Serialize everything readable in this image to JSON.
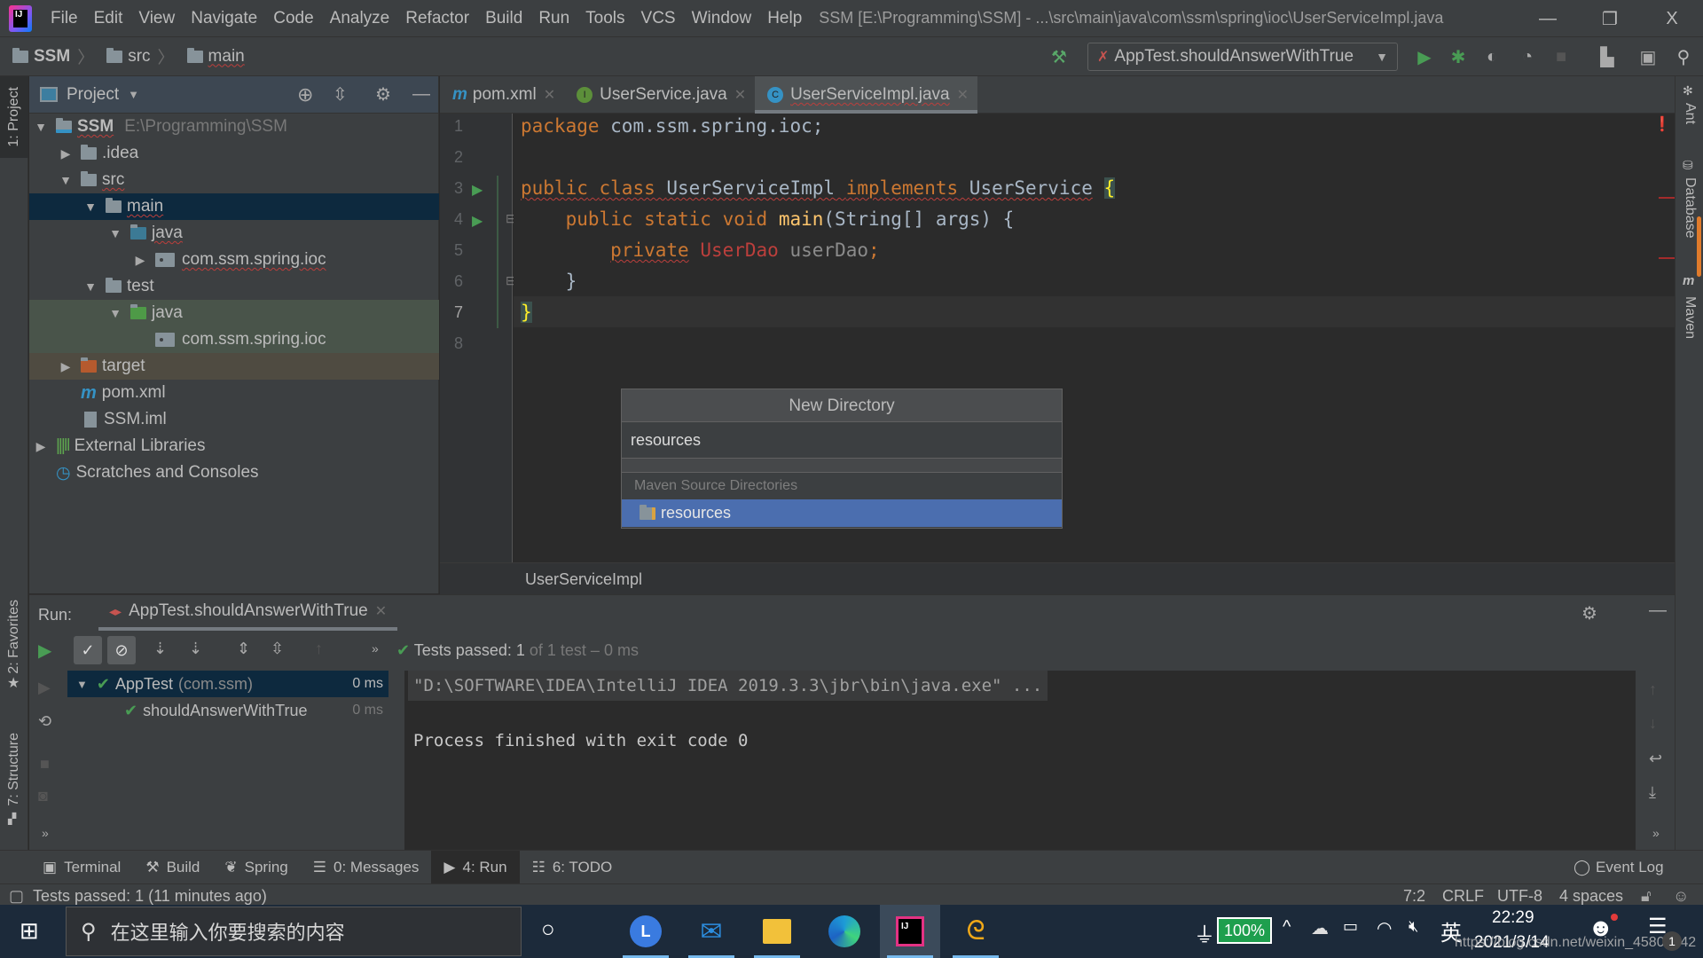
{
  "app": {
    "logo_text": "IJ",
    "window_title": "SSM [E:\\Programming\\SSM] - ...\\src\\main\\java\\com\\ssm\\spring\\ioc\\UserServiceImpl.java",
    "menu": [
      "File",
      "Edit",
      "View",
      "Navigate",
      "Code",
      "Analyze",
      "Refactor",
      "Build",
      "Run",
      "Tools",
      "VCS",
      "Window",
      "Help"
    ],
    "window_controls": {
      "minimize": "—",
      "restore": "❐",
      "close": "X"
    }
  },
  "navbar": {
    "breadcrumbs": [
      "SSM",
      "src",
      "main"
    ],
    "run_config": "AppTest.shouldAnswerWithTrue"
  },
  "left_strip": {
    "project": "1: Project",
    "favorites": "2: Favorites",
    "structure": "7: Structure"
  },
  "right_strip": {
    "ant": "Ant",
    "database": "Database",
    "maven": "Maven"
  },
  "project_panel": {
    "title": "Project",
    "tree": [
      {
        "label": "SSM",
        "path": "E:\\Programming\\SSM",
        "depth": 0,
        "expanded": true,
        "icon": "module-folder-icon"
      },
      {
        "label": ".idea",
        "depth": 1,
        "expanded": false,
        "icon": "folder-icon"
      },
      {
        "label": "src",
        "depth": 1,
        "expanded": true,
        "icon": "folder-icon"
      },
      {
        "label": "main",
        "depth": 2,
        "expanded": true,
        "icon": "folder-icon",
        "selected": true
      },
      {
        "label": "java",
        "depth": 3,
        "expanded": true,
        "icon": "source-folder-icon"
      },
      {
        "label": "com.ssm.spring.ioc",
        "depth": 4,
        "expanded": false,
        "icon": "package-icon"
      },
      {
        "label": "test",
        "depth": 2,
        "expanded": true,
        "icon": "folder-icon"
      },
      {
        "label": "java",
        "depth": 3,
        "expanded": true,
        "icon": "test-folder-icon"
      },
      {
        "label": "com.ssm.spring.ioc",
        "depth": 4,
        "icon": "package-icon"
      },
      {
        "label": "target",
        "depth": 1,
        "expanded": false,
        "icon": "excluded-folder-icon"
      },
      {
        "label": "pom.xml",
        "depth": 1,
        "icon": "maven-icon"
      },
      {
        "label": "SSM.iml",
        "depth": 1,
        "icon": "iml-file-icon"
      },
      {
        "label": "External Libraries",
        "depth": 0,
        "expanded": false,
        "icon": "libraries-icon"
      },
      {
        "label": "Scratches and Consoles",
        "depth": 0,
        "icon": "scratches-icon"
      }
    ]
  },
  "editor": {
    "tabs": [
      {
        "label": "pom.xml",
        "icon": "m"
      },
      {
        "label": "UserService.java",
        "icon": "I"
      },
      {
        "label": "UserServiceImpl.java",
        "icon": "C",
        "active": true
      }
    ],
    "line_numbers": [
      "1",
      "2",
      "3",
      "4",
      "5",
      "6",
      "7",
      "8"
    ],
    "code": {
      "l1_kw": "package",
      "l1_rest": " com.ssm.spring.ioc;",
      "l3_kw1": "public",
      "l3_kw2": "class",
      "l3_name": "UserServiceImpl",
      "l3_kw3": "implements",
      "l3_iface": "UserService",
      "l3_brace": "{",
      "l4_kw": "public static void",
      "l4_fn": "main",
      "l4_rest": "(String[] args) {",
      "l5_kw": "private",
      "l5_type": "UserDao",
      "l5_var": "userDao",
      "l6": "}",
      "l7": "}"
    },
    "breadcrumb": "UserServiceImpl"
  },
  "new_directory_popup": {
    "title": "New Directory",
    "input_value": "resources",
    "section_label": "Maven Source Directories",
    "suggestion": "resources"
  },
  "run_panel": {
    "label": "Run:",
    "tab": "AppTest.shouldAnswerWithTrue",
    "status_prefix": "Tests passed:",
    "status_count": "1",
    "status_suffix": "of 1 test – 0 ms",
    "tests": [
      {
        "name": "AppTest",
        "pkg": "(com.ssm)",
        "time": "0 ms"
      },
      {
        "name": "shouldAnswerWithTrue",
        "time": "0 ms"
      }
    ],
    "console": [
      "\"D:\\SOFTWARE\\IDEA\\IntelliJ IDEA 2019.3.3\\jbr\\bin\\java.exe\" ...",
      "Process finished with exit code 0"
    ]
  },
  "tool_tabs": [
    {
      "label": "Terminal"
    },
    {
      "label": "Build"
    },
    {
      "label": "Spring"
    },
    {
      "label": "0: Messages"
    },
    {
      "label": "4: Run",
      "active": true
    },
    {
      "label": "6: TODO"
    }
  ],
  "event_log": "Event Log",
  "statusbar": {
    "message": "Tests passed: 1 (11 minutes ago)",
    "position": "7:2",
    "line_sep": "CRLF",
    "encoding": "UTF-8",
    "indent": "4 spaces"
  },
  "taskbar": {
    "search_placeholder": "在这里输入你要搜索的内容",
    "battery": "100%",
    "ime": "英",
    "time": "22:29",
    "date": "2021/3/14",
    "watermark": "https://blog.csdn.net/weixin_45801042",
    "notification_count": "1"
  }
}
